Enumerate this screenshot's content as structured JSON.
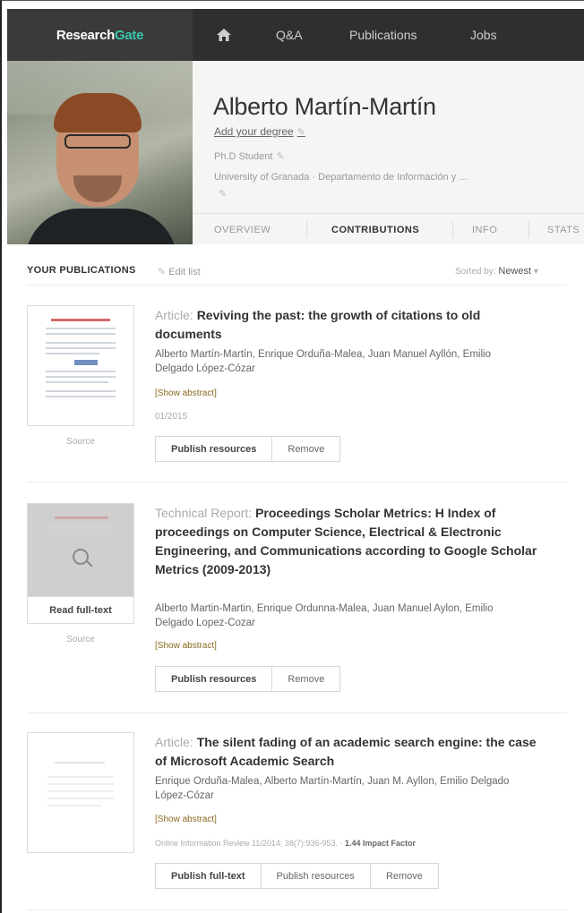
{
  "nav": {
    "logo_part1": "Research",
    "logo_part2": "Gate",
    "home_icon": "home-icon",
    "items": [
      "Q&A",
      "Publications",
      "Jobs"
    ]
  },
  "profile": {
    "name": "Alberto Martín-Martín",
    "add_degree": "Add your degree",
    "role": "Ph.D Student",
    "affiliation": "University of Granada · Departamento de Información y ...",
    "tabs": [
      "OVERVIEW",
      "CONTRIBUTIONS",
      "INFO",
      "STATS"
    ],
    "active_tab": "CONTRIBUTIONS"
  },
  "list": {
    "title": "YOUR PUBLICATIONS",
    "edit": "Edit list",
    "sort_label": "Sorted by:",
    "sort_value": "Newest"
  },
  "publications": [
    {
      "type": "Article:",
      "title": "Reviving the past: the growth of citations to old documents",
      "authors": "Alberto Martín-Martín, Enrique Orduña-Malea, Juan Manuel Ayllón, Emilio Delgado López-Cózar",
      "abstract": "[Show abstract]",
      "date": "01/2015",
      "source": "Source",
      "buttons": [
        "Publish resources",
        "Remove"
      ]
    },
    {
      "type": "Technical Report:",
      "title": "Proceedings Scholar Metrics: H Index of proceedings on Computer Science, Electrical & Electronic Engineering, and Communications according to Google Scholar Metrics (2009-2013)",
      "authors": "Alberto Martin-Martin, Enrique Ordunna-Malea, Juan Manuel Aylon, Emilio Delgado Lopez-Cozar",
      "abstract": "[Show abstract]",
      "read_fulltext": "Read full-text",
      "source": "Source",
      "buttons": [
        "Publish resources",
        "Remove"
      ]
    },
    {
      "type": "Article:",
      "title": "The silent fading of an academic search engine: the case of Microsoft Academic Search",
      "authors": "Enrique Orduña-Malea, Alberto Martín-Martín, Juan M. Ayllon, Emilio Delgado López-Cózar",
      "abstract": "[Show abstract]",
      "meta": "Online Information Review 11/2014; 38(7):936-953. ·",
      "impact": "1.44 Impact Factor",
      "buttons": [
        "Publish full-text",
        "Publish resources",
        "Remove"
      ]
    }
  ],
  "colors": {
    "nav_bg": "#2f2f2f",
    "logo_accent": "#39c6b0",
    "abstract_link": "#8a6b1f"
  }
}
